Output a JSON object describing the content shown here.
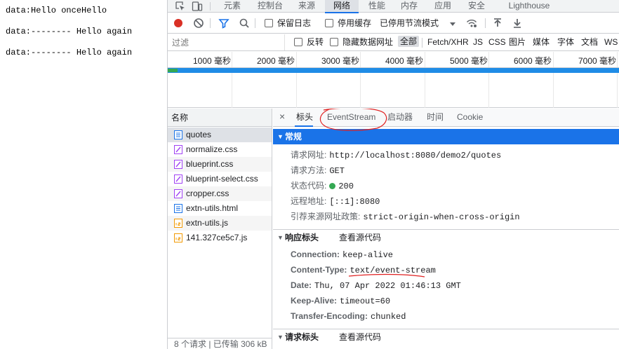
{
  "page": {
    "lines": [
      "data:Hello onceHello",
      "data:-------- Hello again",
      "data:-------- Hello again"
    ]
  },
  "devtools": {
    "tabs": [
      "元素",
      "控制台",
      "来源",
      "网络",
      "性能",
      "内存",
      "应用",
      "安全",
      "Lighthouse"
    ],
    "active_tab": "网络",
    "toolbar": {
      "preserve_log": "保留日志",
      "disable_cache": "停用缓存",
      "throttling": "已停用节流模式"
    },
    "filter": {
      "placeholder": "过滤",
      "invert": "反转",
      "hide_data_urls": "隐藏数据网址",
      "types": [
        "全部",
        "Fetch/XHR",
        "JS",
        "CSS",
        "图片",
        "媒体",
        "字体",
        "文档",
        "WS"
      ],
      "active_type": "全部"
    },
    "timeline": {
      "ticks": [
        "1000 毫秒",
        "2000 毫秒",
        "3000 毫秒",
        "4000 毫秒",
        "5000 毫秒",
        "6000 毫秒",
        "7000 毫秒"
      ]
    },
    "requests": {
      "header": "名称",
      "items": [
        {
          "name": "quotes",
          "type": "doc"
        },
        {
          "name": "normalize.css",
          "type": "css"
        },
        {
          "name": "blueprint.css",
          "type": "css"
        },
        {
          "name": "blueprint-select.css",
          "type": "css"
        },
        {
          "name": "cropper.css",
          "type": "css"
        },
        {
          "name": "extn-utils.html",
          "type": "doc"
        },
        {
          "name": "extn-utils.js",
          "type": "js"
        },
        {
          "name": "141.327ce5c7.js",
          "type": "js"
        }
      ],
      "status": "8 个请求 | 已传输 306 kB"
    },
    "details": {
      "close": "×",
      "tabs": [
        "标头",
        "EventStream",
        "启动器",
        "时间",
        "Cookie"
      ],
      "active_tab": "标头",
      "general": {
        "title": "常规",
        "rows": [
          {
            "key": "请求网址:",
            "value": "http://localhost:8080/demo2/quotes"
          },
          {
            "key": "请求方法:",
            "value": "GET"
          },
          {
            "key": "状态代码:",
            "value": "200"
          },
          {
            "key": "远程地址:",
            "value": "[::1]:8080"
          },
          {
            "key": "引荐来源网址政策:",
            "value": "strict-origin-when-cross-origin"
          }
        ]
      },
      "response_headers": {
        "title": "响应标头",
        "view_source": "查看源代码",
        "rows": [
          {
            "key": "Connection:",
            "value": "keep-alive"
          },
          {
            "key": "Content-Type:",
            "value": "text/event-stream"
          },
          {
            "key": "Date:",
            "value": "Thu, 07 Apr 2022 01:46:13 GMT"
          },
          {
            "key": "Keep-Alive:",
            "value": "timeout=60"
          },
          {
            "key": "Transfer-Encoding:",
            "value": "chunked"
          }
        ]
      },
      "request_headers": {
        "title": "请求标头",
        "view_source": "查看源代码"
      }
    },
    "colors": {
      "accent": "#1a73e8",
      "record_red": "#d93025",
      "status_green": "#34a853",
      "annotation_red": "#e02020"
    }
  }
}
